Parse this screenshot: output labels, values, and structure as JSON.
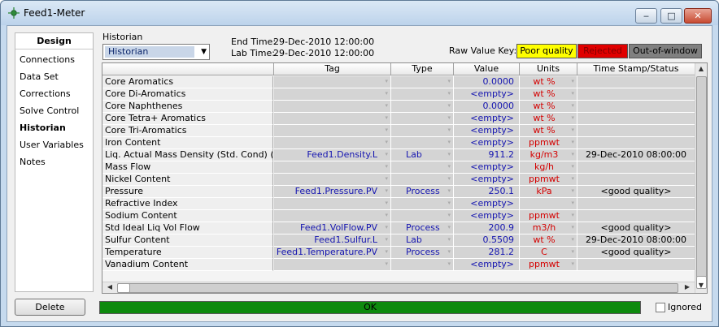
{
  "window": {
    "title": "Feed1-Meter",
    "minimize_glyph": "‒",
    "maximize_glyph": "□",
    "close_glyph": "✕"
  },
  "nav": {
    "header": "Design",
    "items": [
      {
        "label": "Connections"
      },
      {
        "label": "Data Set"
      },
      {
        "label": "Corrections"
      },
      {
        "label": "Solve Control"
      },
      {
        "label": "Historian"
      },
      {
        "label": "User Variables"
      },
      {
        "label": "Notes"
      }
    ],
    "active": "Historian"
  },
  "historian": {
    "label": "Historian",
    "combo_value": "Historian",
    "end_time_label": "End Time:",
    "end_time": "29-Dec-2010 12:00:00",
    "lab_time_label": "Lab Time:",
    "lab_time": "29-Dec-2010 12:00:00"
  },
  "raw_key": {
    "label": "Raw Value Key:",
    "poor_quality": "Poor quality",
    "rejected": "Rejected",
    "out_of_window": "Out-of-window",
    "colors": {
      "poor_quality": "#ffff00",
      "rejected": "#e00000",
      "out_of_window": "#808080"
    }
  },
  "grid": {
    "columns": {
      "tag": "Tag",
      "type": "Type",
      "value": "Value",
      "units": "Units",
      "timestamp": "Time Stamp/Status"
    },
    "rows": [
      {
        "prop": "Core Aromatics",
        "tag": "",
        "type": "",
        "value": "0.0000",
        "units": "wt %",
        "ts": ""
      },
      {
        "prop": "Core Di-Aromatics",
        "tag": "",
        "type": "",
        "value": "<empty>",
        "units": "wt %",
        "ts": ""
      },
      {
        "prop": "Core Naphthenes",
        "tag": "",
        "type": "",
        "value": "0.0000",
        "units": "wt %",
        "ts": ""
      },
      {
        "prop": "Core Tetra+ Aromatics",
        "tag": "",
        "type": "",
        "value": "<empty>",
        "units": "wt %",
        "ts": ""
      },
      {
        "prop": "Core Tri-Aromatics",
        "tag": "",
        "type": "",
        "value": "<empty>",
        "units": "wt %",
        "ts": ""
      },
      {
        "prop": "Iron Content",
        "tag": "",
        "type": "",
        "value": "<empty>",
        "units": "ppmwt",
        "ts": ""
      },
      {
        "prop": "Liq. Actual Mass Density (Std. Cond) (Dry)",
        "tag": "Feed1.Density.L",
        "type": "Lab",
        "value": "911.2",
        "units": "kg/m3",
        "ts": "29-Dec-2010 08:00:00"
      },
      {
        "prop": "Mass Flow",
        "tag": "",
        "type": "",
        "value": "<empty>",
        "units": "kg/h",
        "ts": ""
      },
      {
        "prop": "Nickel Content",
        "tag": "",
        "type": "",
        "value": "<empty>",
        "units": "ppmwt",
        "ts": ""
      },
      {
        "prop": "Pressure",
        "tag": "Feed1.Pressure.PV",
        "type": "Process",
        "value": "250.1",
        "units": "kPa",
        "ts": "<good quality>"
      },
      {
        "prop": "Refractive Index",
        "tag": "",
        "type": "",
        "value": "<empty>",
        "units": "",
        "ts": ""
      },
      {
        "prop": "Sodium Content",
        "tag": "",
        "type": "",
        "value": "<empty>",
        "units": "ppmwt",
        "ts": ""
      },
      {
        "prop": "Std Ideal Liq Vol Flow",
        "tag": "Feed1.VolFlow.PV",
        "type": "Process",
        "value": "200.9",
        "units": "m3/h",
        "ts": "<good quality>"
      },
      {
        "prop": "Sulfur Content",
        "tag": "Feed1.Sulfur.L",
        "type": "Lab",
        "value": "0.5509",
        "units": "wt %",
        "ts": "29-Dec-2010 08:00:00"
      },
      {
        "prop": "Temperature",
        "tag": "Feed1.Temperature.PV",
        "type": "Process",
        "value": "281.2",
        "units": "C",
        "ts": "<good quality>"
      },
      {
        "prop": "Vanadium Content",
        "tag": "",
        "type": "",
        "value": "<empty>",
        "units": "ppmwt",
        "ts": ""
      }
    ]
  },
  "footer": {
    "delete_label": "Delete",
    "status": "OK",
    "status_color": "#0e8a0e",
    "ignored_label": "Ignored",
    "ignored_checked": false
  }
}
